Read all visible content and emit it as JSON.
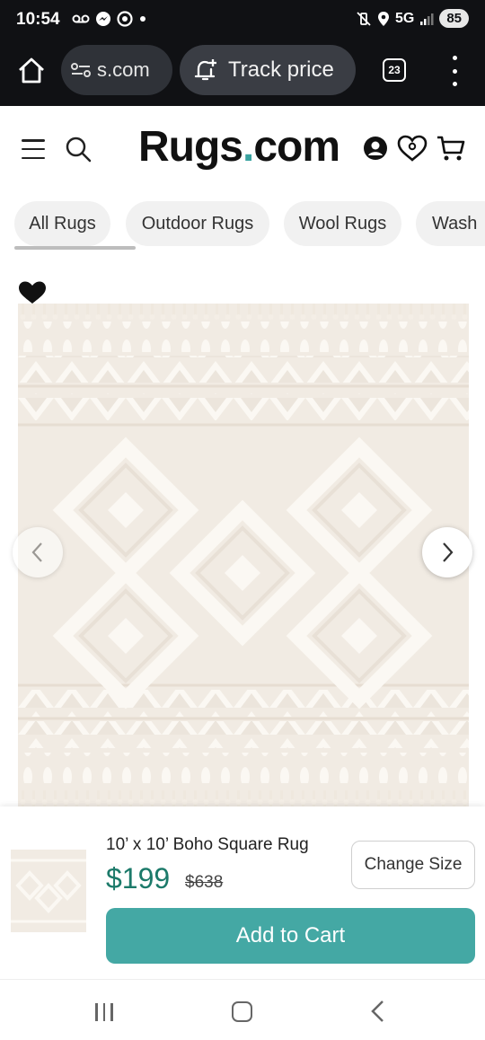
{
  "status_bar": {
    "time": "10:54",
    "network": "5G",
    "battery": "85",
    "icons": [
      "voicemail-icon",
      "messenger-icon",
      "circle-notification-icon",
      "dot-icon",
      "mute-vibrate-icon",
      "location-icon",
      "signal-icon"
    ]
  },
  "browser": {
    "url": "s.com",
    "track_price_label": "Track price",
    "tab_count": "23"
  },
  "site": {
    "logo_main": "Rugs",
    "logo_dot": ".",
    "logo_tld": "com"
  },
  "categories": [
    {
      "label": "All Rugs"
    },
    {
      "label": "Outdoor Rugs"
    },
    {
      "label": "Wool Rugs"
    },
    {
      "label": "Wash"
    }
  ],
  "product": {
    "title": "10’ x 10’ Boho Square Rug",
    "price": "$199",
    "original_price": "$638",
    "change_size_label": "Change Size",
    "add_to_cart_label": "Add to Cart"
  },
  "colors": {
    "brand_teal": "#44a8a4",
    "price_green": "#1c7a6a",
    "logo_dot": "#3aa3a0"
  }
}
